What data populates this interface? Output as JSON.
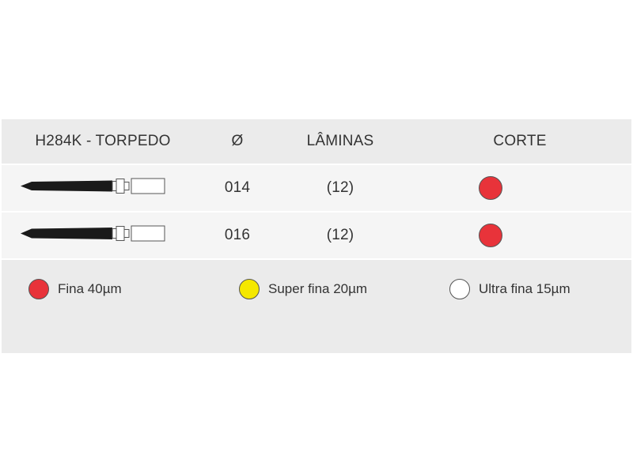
{
  "header": {
    "name": "H284K - TORPEDO",
    "diameter": "Ø",
    "blades": "LÂMINAS",
    "cut": "CORTE"
  },
  "rows": [
    {
      "diameter": "014",
      "blades": "(12)",
      "cut_color": "#e8333a",
      "tool_icon": "torpedo-bur-icon"
    },
    {
      "diameter": "016",
      "blades": "(12)",
      "cut_color": "#e8333a",
      "tool_icon": "torpedo-bur-icon"
    }
  ],
  "legend": [
    {
      "label": "Fina 40µm",
      "color": "#e8333a"
    },
    {
      "label": "Super fina 20µm",
      "color": "#f5e800"
    },
    {
      "label": "Ultra fina 15µm",
      "color": "#ffffff"
    }
  ]
}
